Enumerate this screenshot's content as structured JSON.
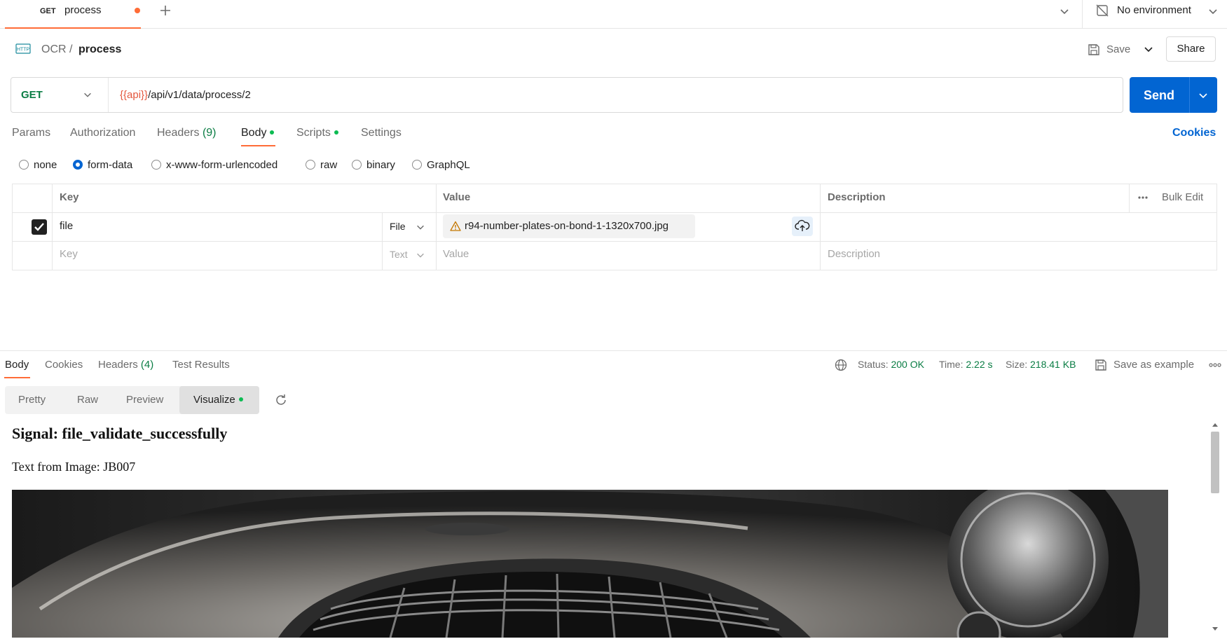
{
  "tabbar": {
    "tab_method": "GET",
    "tab_title": "process",
    "environment": "No environment"
  },
  "breadcrumb": {
    "collection": "OCR",
    "separator": "/",
    "request": "process",
    "save_label": "Save",
    "share_label": "Share"
  },
  "request": {
    "method": "GET",
    "url_variable": "{{api}}",
    "url_path": "/api/v1/data/process/2",
    "send_label": "Send"
  },
  "request_tabs": {
    "params": "Params",
    "authorization": "Authorization",
    "headers": "Headers",
    "headers_count": "(9)",
    "body": "Body",
    "scripts": "Scripts",
    "settings": "Settings",
    "cookies": "Cookies"
  },
  "body_types": [
    "none",
    "form-data",
    "x-www-form-urlencoded",
    "raw",
    "binary",
    "GraphQL"
  ],
  "body_type_selected": "form-data",
  "form_table": {
    "headers": {
      "key": "Key",
      "value": "Value",
      "description": "Description",
      "bulk_edit": "Bulk Edit"
    },
    "rows": [
      {
        "checked": true,
        "key": "file",
        "type": "File",
        "value": "r94-number-plates-on-bond-1-1320x700.jpg",
        "description": ""
      }
    ],
    "placeholder": {
      "key": "Key",
      "type": "Text",
      "value": "Value",
      "description": "Description"
    }
  },
  "response": {
    "tabs": {
      "body": "Body",
      "cookies": "Cookies",
      "headers": "Headers",
      "headers_count": "(4)",
      "test_results": "Test Results"
    },
    "status_label": "Status:",
    "status_value": "200 OK",
    "time_label": "Time:",
    "time_value": "2.22 s",
    "size_label": "Size:",
    "size_value": "218.41 KB",
    "save_example": "Save as example",
    "views": [
      "Pretty",
      "Raw",
      "Preview",
      "Visualize"
    ],
    "view_selected": "Visualize"
  },
  "visualize": {
    "heading": "Signal: file_validate_successfully",
    "text": "Text from Image: JB007"
  },
  "colors": {
    "accent_orange": "#ff6c37",
    "send_blue": "#0265d2",
    "method_green": "#0a7d44",
    "status_green": "#0a7d44",
    "variable_red": "#e4573d"
  },
  "icons": {
    "tab_add": "plus-icon",
    "environment": "no-environment-icon",
    "request_type": "http-icon",
    "save": "save-icon",
    "warning": "warning-icon",
    "upload": "cloud-upload-icon",
    "network": "globe-icon",
    "refresh": "refresh-icon"
  }
}
